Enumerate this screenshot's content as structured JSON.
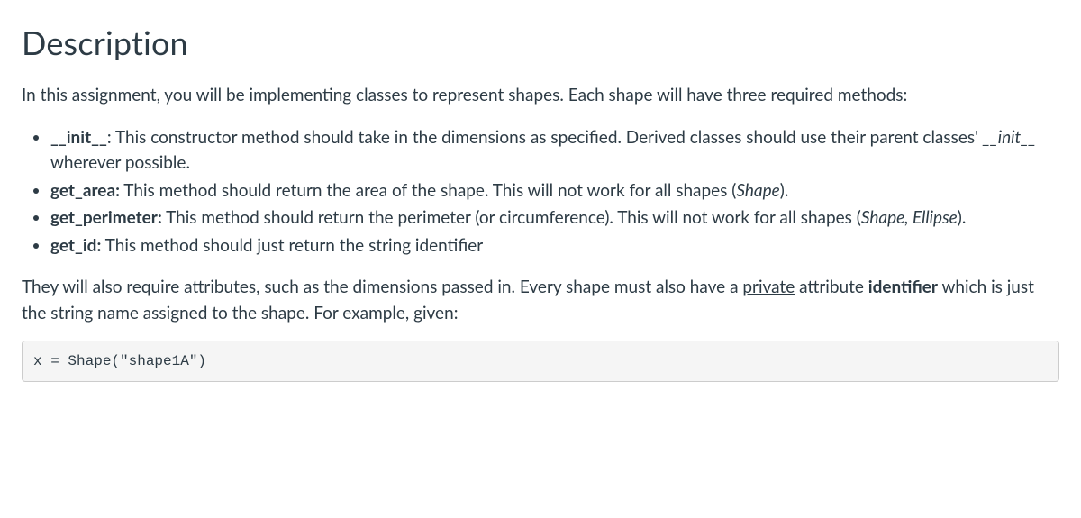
{
  "heading": "Description",
  "intro": "In this assignment, you will be implementing classes to represent shapes. Each shape will have three required methods:",
  "methods": [
    {
      "name": "__init__",
      "desc_before": ": This constructor method should take in the dimensions as specified. Derived classes should use their parent classes' ",
      "inline_italic": "__init__",
      "desc_after": " wherever possible."
    },
    {
      "name": "get_area:",
      "desc_before": " This method should return the area of the shape. This will not work for all shapes (",
      "inline_italic": "Shape",
      "desc_after": ")."
    },
    {
      "name": "get_perimeter:",
      "desc_before": " This method should return the perimeter (or circumference). This will not work for all shapes (",
      "inline_italic": "Shape, Ellipse",
      "desc_after": ")."
    },
    {
      "name": "get_id:",
      "desc_before": " This method should just return the string identifier",
      "inline_italic": "",
      "desc_after": ""
    }
  ],
  "attrs": {
    "prefix": "They will also require attributes, such as the dimensions passed in. Every shape must also have a ",
    "underlined": "private",
    "mid": " attribute ",
    "bold": "identifier",
    "suffix": " which is just the string name assigned to the shape. For example, given:"
  },
  "code": "x = Shape(\"shape1A\")"
}
